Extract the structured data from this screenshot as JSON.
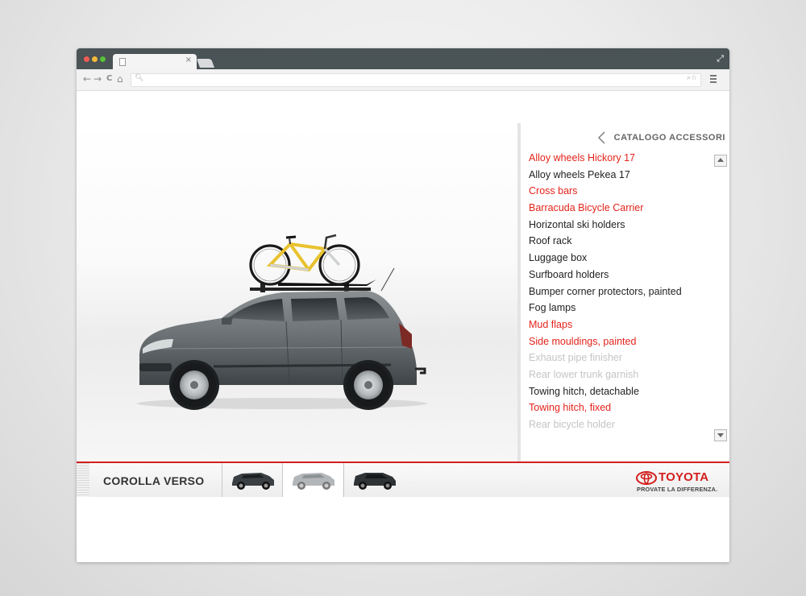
{
  "browser": {
    "tab_close": "×",
    "nav": {
      "back": "←",
      "forward": "→",
      "reload": "C",
      "home": "⌂"
    },
    "url": ""
  },
  "panel": {
    "title": "CATALOGO ACCESSORI",
    "items": [
      {
        "label": "Alloy wheels Hickory 17",
        "state": "highlighted"
      },
      {
        "label": "Alloy wheels Pekea 17",
        "state": "normal"
      },
      {
        "label": "Cross bars",
        "state": "highlighted"
      },
      {
        "label": "Barracuda Bicycle Carrier",
        "state": "highlighted"
      },
      {
        "label": "Horizontal ski holders",
        "state": "normal"
      },
      {
        "label": "Roof rack",
        "state": "normal"
      },
      {
        "label": "Luggage box",
        "state": "normal"
      },
      {
        "label": "Surfboard holders",
        "state": "normal"
      },
      {
        "label": "Bumper corner protectors, painted",
        "state": "normal"
      },
      {
        "label": "Fog lamps",
        "state": "normal"
      },
      {
        "label": "Mud flaps",
        "state": "highlighted"
      },
      {
        "label": "Side mouldings, painted",
        "state": "highlighted"
      },
      {
        "label": "Exhaust pipe finisher",
        "state": "disabled"
      },
      {
        "label": "Rear lower trunk garnish",
        "state": "disabled"
      },
      {
        "label": "Towing hitch, detachable",
        "state": "normal"
      },
      {
        "label": "Towing hitch, fixed",
        "state": "highlighted"
      },
      {
        "label": "Rear bicycle holder",
        "state": "disabled"
      }
    ]
  },
  "bottom": {
    "model_name": "COROLLA VERSO",
    "thumbnails": [
      {
        "name": "thumb-dark-suv",
        "active": false
      },
      {
        "name": "thumb-silver-suv",
        "active": true
      },
      {
        "name": "thumb-dark-suv-2",
        "active": false
      }
    ]
  },
  "brand": {
    "name": "TOYOTA",
    "slogan": "PROVATE LA DIFFERENZA.",
    "color": "#d21f1b"
  },
  "colors": {
    "highlight": "#e3231b",
    "disabled": "#c4c4c4",
    "text": "#222222"
  }
}
